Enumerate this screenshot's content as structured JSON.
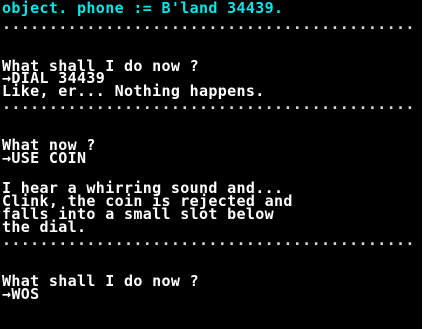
{
  "colors": {
    "background": "#000000",
    "accent": "#00e8e8",
    "text": "#ffffff"
  },
  "header": {
    "location_text": "object. phone := B'land 34439."
  },
  "separator": "............................................",
  "blocks": [
    {
      "prompt": "What shall I do now ?",
      "command": "→DIAL 34439",
      "response": [
        "Like, er... Nothing happens."
      ]
    },
    {
      "prompt": "What now ?",
      "command": "→USE COIN",
      "response": [
        "I hear a whirring sound and...",
        "Clink, the coin is rejected and",
        "falls into a small slot below",
        "the dial."
      ]
    },
    {
      "prompt": "What shall I do now ?",
      "command": "→WOS",
      "response": []
    }
  ]
}
